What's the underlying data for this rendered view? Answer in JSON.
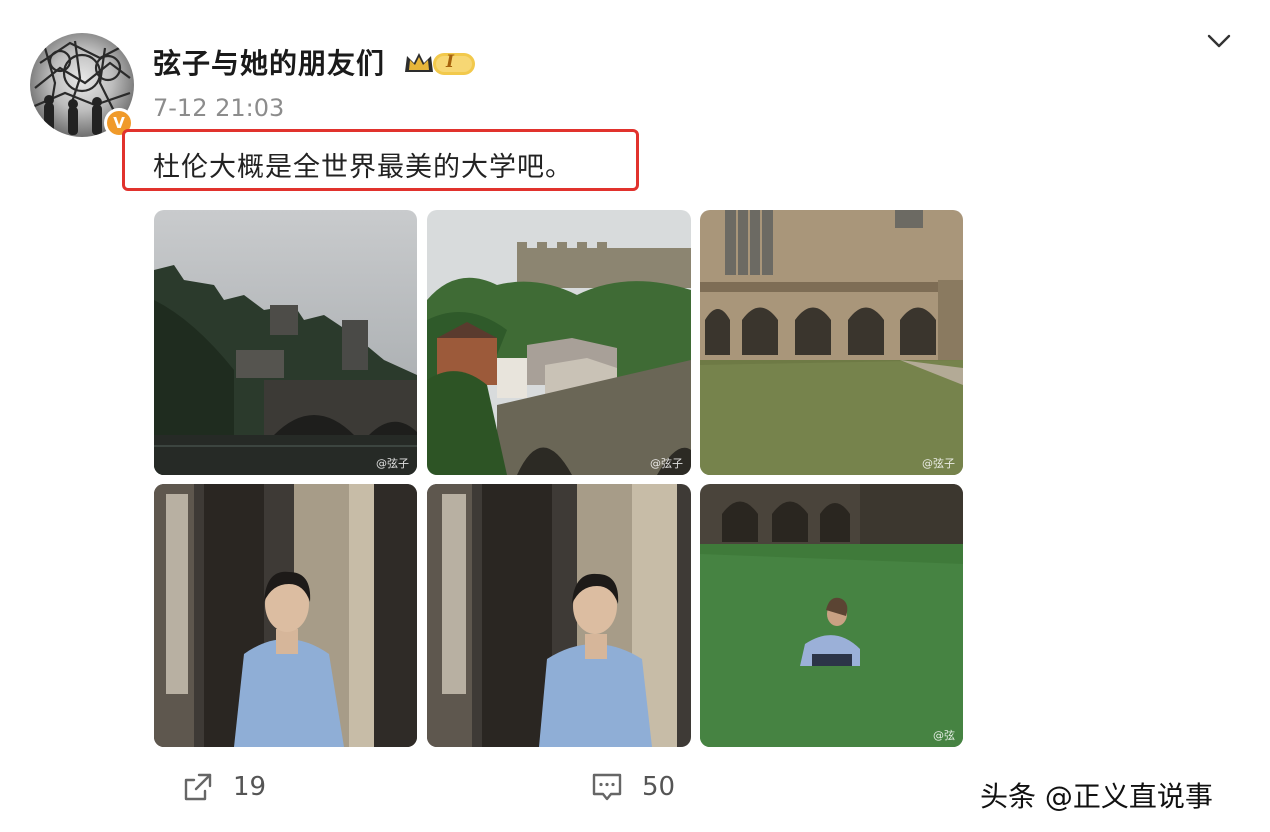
{
  "post": {
    "author": "弦子与她的朋友们",
    "level_badge": "I",
    "timestamp": "7-12 21:03",
    "verified_mark": "V",
    "text": "杜伦大概是全世界最美的大学吧。",
    "images": [
      {
        "watermark": "@弦子"
      },
      {
        "watermark": "@弦子"
      },
      {
        "watermark": "@弦子"
      },
      {
        "watermark": ""
      },
      {
        "watermark": ""
      },
      {
        "watermark": "@弦"
      }
    ],
    "actions": {
      "repost_count": "19",
      "comment_count": "50"
    }
  },
  "source_watermark": "头条 @正义直说事",
  "colors": {
    "highlight_border": "#e1322d",
    "verified_badge": "#f09a2a",
    "crown_gold": "#e8b63a"
  },
  "icons": [
    "chevron-down-icon",
    "crown-icon",
    "repost-icon",
    "comment-icon"
  ]
}
